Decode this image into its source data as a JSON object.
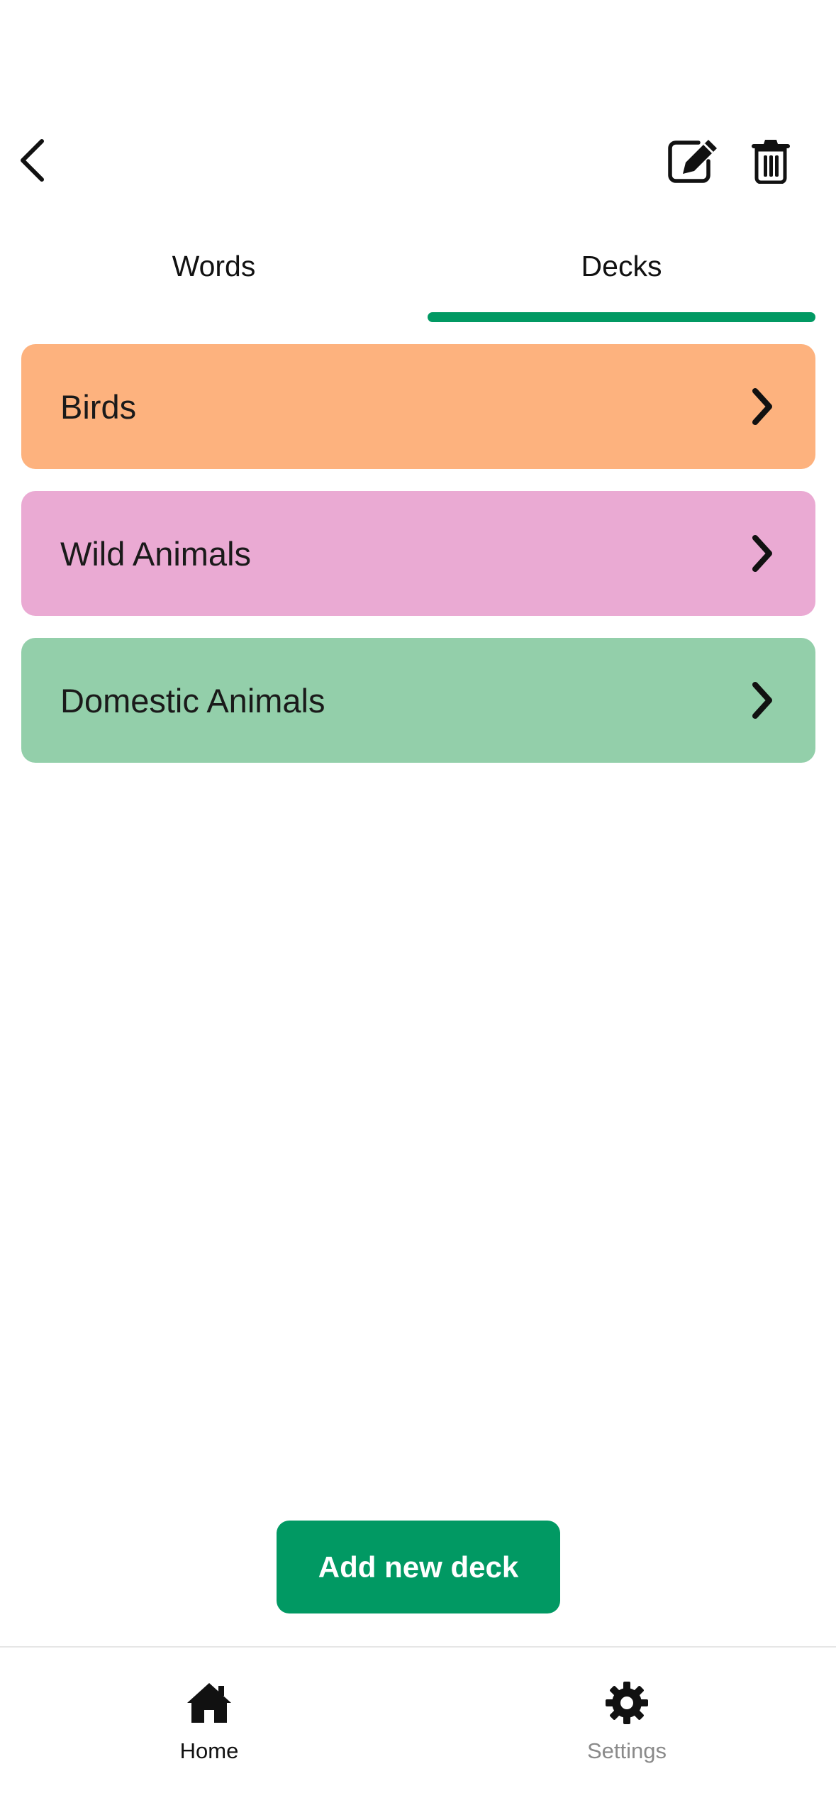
{
  "header": {
    "back_icon": "chevron-left-icon",
    "edit_icon": "edit-icon",
    "delete_icon": "trash-icon"
  },
  "tabs": [
    {
      "label": "Words",
      "active": false
    },
    {
      "label": "Decks",
      "active": true
    }
  ],
  "decks": [
    {
      "label": "Birds",
      "color": "#FDB27E"
    },
    {
      "label": "Wild Animals",
      "color": "#EAAAD3"
    },
    {
      "label": "Domestic Animals",
      "color": "#93CFAA"
    }
  ],
  "add_button": {
    "label": "Add new deck"
  },
  "bottom_nav": {
    "items": [
      {
        "label": "Home",
        "icon": "home-icon",
        "active": true
      },
      {
        "label": "Settings",
        "icon": "gear-icon",
        "active": false
      }
    ]
  },
  "colors": {
    "accent": "#019963",
    "inactive_text": "#8A8A8A"
  }
}
